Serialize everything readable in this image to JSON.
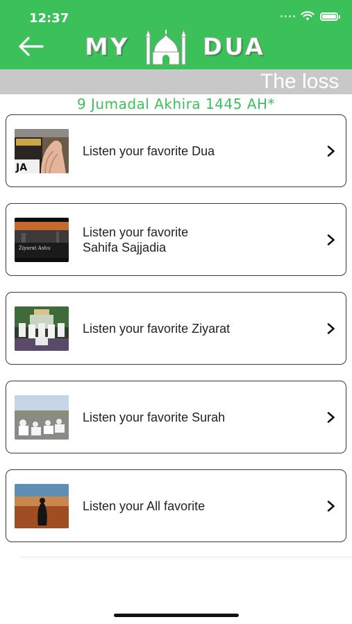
{
  "status_bar": {
    "time": "12:37"
  },
  "header": {
    "logo_left": "MY",
    "logo_right": "DUA",
    "background": "#3cc15a",
    "back_icon": "arrow-left-icon"
  },
  "marquee": {
    "text": "The loss"
  },
  "hijri_date": "9 Jumadal Akhira 1445 AH*",
  "menu": [
    {
      "label": "Listen your favorite Dua",
      "thumbnail": "dua-thumbnail",
      "thumb_caption": "JA"
    },
    {
      "label": "Listen your favorite\nSahifa Sajjadia",
      "thumbnail": "sahifa-thumbnail",
      "thumb_caption": "Ziyarat Ashu"
    },
    {
      "label": "Listen your favorite Ziyarat",
      "thumbnail": "ziyarat-thumbnail"
    },
    {
      "label": "Listen your favorite Surah",
      "thumbnail": "surah-thumbnail"
    },
    {
      "label": "Listen your All favorite",
      "thumbnail": "all-favorite-thumbnail"
    }
  ],
  "colors": {
    "accent": "#3cc15a",
    "banner": "#c8c8c8",
    "card_border": "#3a3a3a"
  }
}
